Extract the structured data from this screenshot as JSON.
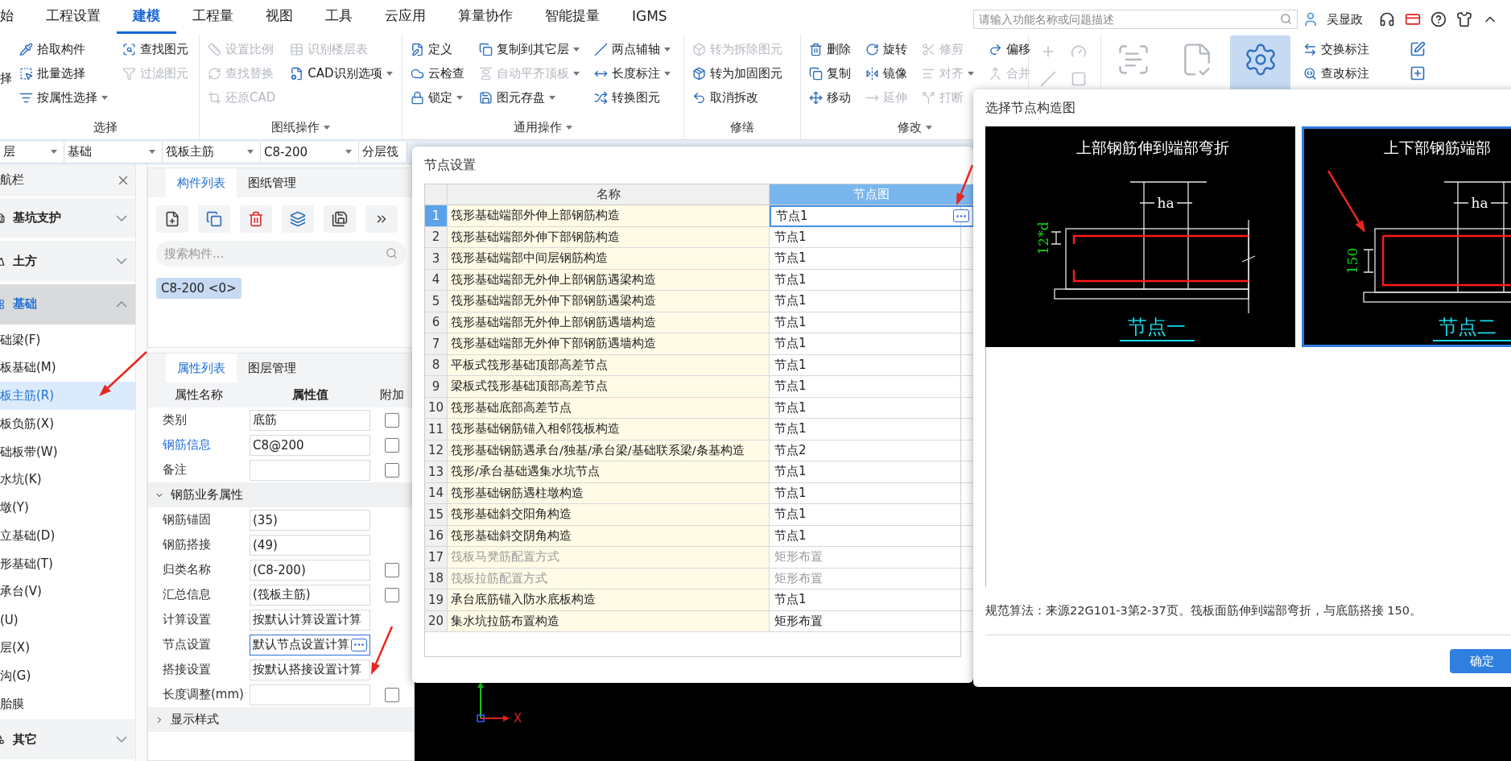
{
  "menu_tabs": [
    {
      "label": "始",
      "selected": false
    },
    {
      "label": "工程设置",
      "selected": false
    },
    {
      "label": "建模",
      "selected": true
    },
    {
      "label": "工程量",
      "selected": false
    },
    {
      "label": "视图",
      "selected": false
    },
    {
      "label": "工具",
      "selected": false
    },
    {
      "label": "云应用",
      "selected": false
    },
    {
      "label": "算量协作",
      "selected": false
    },
    {
      "label": "智能提量",
      "selected": false
    },
    {
      "label": "IGMS",
      "selected": false
    }
  ],
  "search": {
    "placeholder": "请输入功能名称或问题描述"
  },
  "user": {
    "name": "吴显政"
  },
  "ribbon": {
    "lead_button": {
      "label": "择"
    },
    "groups": [
      {
        "label": "选择",
        "has_menu": false,
        "columns": [
          [
            {
              "label": "拾取构件",
              "disabled": false,
              "dropdown": false
            },
            {
              "label": "批量选择",
              "disabled": false,
              "dropdown": false
            },
            {
              "label": "按属性选择",
              "disabled": false,
              "dropdown": true
            }
          ],
          [
            {
              "label": "查找图元",
              "disabled": false,
              "dropdown": false
            },
            {
              "label": "过滤图元",
              "disabled": true,
              "dropdown": false
            }
          ]
        ]
      },
      {
        "label": "图纸操作",
        "has_menu": true,
        "columns": [
          [
            {
              "label": "设置比例",
              "disabled": true,
              "dropdown": false
            },
            {
              "label": "查找替换",
              "disabled": true,
              "dropdown": false
            },
            {
              "label": "还原CAD",
              "disabled": true,
              "dropdown": false
            }
          ],
          [
            {
              "label": "识别楼层表",
              "disabled": true,
              "dropdown": false
            },
            {
              "label": "CAD识别选项",
              "disabled": false,
              "dropdown": true
            }
          ]
        ]
      },
      {
        "label": "通用操作",
        "has_menu": true,
        "columns": [
          [
            {
              "label": "定义",
              "disabled": false,
              "dropdown": false
            },
            {
              "label": "云检查",
              "disabled": false,
              "dropdown": false
            },
            {
              "label": "锁定",
              "disabled": false,
              "dropdown": true
            }
          ],
          [
            {
              "label": "复制到其它层",
              "disabled": false,
              "dropdown": true
            },
            {
              "label": "自动平齐顶板",
              "disabled": true,
              "dropdown": true
            },
            {
              "label": "图元存盘",
              "disabled": false,
              "dropdown": true
            }
          ],
          [
            {
              "label": "两点辅轴",
              "disabled": false,
              "dropdown": true
            },
            {
              "label": "长度标注",
              "disabled": false,
              "dropdown": true
            },
            {
              "label": "转换图元",
              "disabled": false,
              "dropdown": false
            }
          ]
        ]
      },
      {
        "label": "修缮",
        "has_menu": false,
        "columns": [
          [
            {
              "label": "转为拆除图元",
              "disabled": true,
              "dropdown": false
            },
            {
              "label": "转为加固图元",
              "disabled": false,
              "dropdown": false
            },
            {
              "label": "取消拆改",
              "disabled": false,
              "dropdown": false
            }
          ]
        ]
      },
      {
        "label": "修改",
        "has_menu": true,
        "columns": [
          [
            {
              "label": "删除",
              "disabled": false,
              "dropdown": false
            },
            {
              "label": "复制",
              "disabled": false,
              "dropdown": false
            },
            {
              "label": "移动",
              "disabled": false,
              "dropdown": false
            }
          ],
          [
            {
              "label": "旋转",
              "disabled": false,
              "dropdown": false
            },
            {
              "label": "镜像",
              "disabled": false,
              "dropdown": false
            },
            {
              "label": "延伸",
              "disabled": true,
              "dropdown": false
            }
          ],
          [
            {
              "label": "修剪",
              "disabled": true,
              "dropdown": false
            },
            {
              "label": "对齐",
              "disabled": true,
              "dropdown": true
            },
            {
              "label": "打断",
              "disabled": true,
              "dropdown": false
            }
          ],
          [
            {
              "label": "偏移",
              "disabled": false,
              "dropdown": false
            },
            {
              "label": "合并",
              "disabled": true,
              "dropdown": false
            }
          ]
        ]
      }
    ],
    "big_buttons": [
      {
        "selected": false,
        "disabled": true
      },
      {
        "selected": false,
        "disabled": true
      },
      {
        "selected": true,
        "disabled": false
      }
    ],
    "label_tools": [
      {
        "label": "交换标注"
      },
      {
        "label": "查改标注"
      }
    ]
  },
  "selector_bar": [
    {
      "value": "层"
    },
    {
      "value": "基础"
    },
    {
      "value": "筏板主筋"
    },
    {
      "value": "C8-200"
    },
    {
      "value": "分层筏"
    }
  ],
  "navigation": {
    "title": "航栏",
    "groups": [
      {
        "label": "基坑支护",
        "expanded": false,
        "selected": false
      },
      {
        "label": "土方",
        "expanded": false,
        "selected": false
      },
      {
        "label": "基础",
        "expanded": true,
        "selected": true,
        "children": [
          {
            "label": "础梁(F)",
            "selected": false
          },
          {
            "label": "板基础(M)",
            "selected": false
          },
          {
            "label": "板主筋(R)",
            "selected": true
          },
          {
            "label": "板负筋(X)",
            "selected": false
          },
          {
            "label": "础板带(W)",
            "selected": false
          },
          {
            "label": "水坑(K)",
            "selected": false
          },
          {
            "label": "墩(Y)",
            "selected": false
          },
          {
            "label": "立基础(D)",
            "selected": false
          },
          {
            "label": "形基础(T)",
            "selected": false
          },
          {
            "label": "承台(V)",
            "selected": false
          },
          {
            "label": "(U)",
            "selected": false
          },
          {
            "label": "层(X)",
            "selected": false
          },
          {
            "label": "沟(G)",
            "selected": false
          },
          {
            "label": "胎膜",
            "selected": false
          }
        ]
      },
      {
        "label": "其它",
        "expanded": false,
        "selected": false
      }
    ]
  },
  "component_panel": {
    "tabs": [
      {
        "label": "构件列表",
        "selected": true
      },
      {
        "label": "图纸管理",
        "selected": false
      }
    ],
    "search": {
      "placeholder": "搜索构件..."
    },
    "items": [
      {
        "label": "C8-200 <0>",
        "selected": true
      }
    ]
  },
  "property_panel": {
    "tabs": [
      {
        "label": "属性列表",
        "selected": true
      },
      {
        "label": "图层管理",
        "selected": false
      }
    ],
    "columns": [
      "属性名称",
      "属性值",
      "附加"
    ],
    "rows": [
      {
        "kind": "row",
        "name": "类别",
        "value": "底筋",
        "link": false,
        "checked": false
      },
      {
        "kind": "row",
        "name": "钢筋信息",
        "value": "C8@200",
        "link": true,
        "checked": false
      },
      {
        "kind": "row",
        "name": "备注",
        "link": false,
        "checked": false
      },
      {
        "kind": "section",
        "label": "钢筋业务属性",
        "expanded": true
      },
      {
        "kind": "row",
        "name": "钢筋锚固",
        "value": "(35)",
        "link": false
      },
      {
        "kind": "row",
        "name": "钢筋搭接",
        "value": "(49)",
        "link": false
      },
      {
        "kind": "row",
        "name": "归类名称",
        "value": "(C8-200)",
        "link": false,
        "checked": false
      },
      {
        "kind": "row",
        "name": "汇总信息",
        "value": "(筏板主筋)",
        "link": false,
        "checked": false
      },
      {
        "kind": "row",
        "name": "计算设置",
        "value": "按默认计算设置计算",
        "link": false
      },
      {
        "kind": "picker",
        "name": "节点设置",
        "value": "默认节点设置计算",
        "link": false,
        "focused": true
      },
      {
        "kind": "row",
        "name": "搭接设置",
        "value": "按默认搭接设置计算",
        "link": false
      },
      {
        "kind": "row",
        "name": "长度调整(mm)",
        "link": false,
        "checked": false
      },
      {
        "kind": "section",
        "label": "显示样式",
        "expanded": false
      }
    ]
  },
  "canvas": {
    "axis_label": "X"
  },
  "node_dialog": {
    "title": "节点设置",
    "columns": [
      "名称",
      "节点图"
    ],
    "rows": [
      {
        "index": "1",
        "name": "筏形基础端部外伸上部钢筋构造",
        "value": "节点1",
        "disabled": false,
        "selected": true
      },
      {
        "index": "2",
        "name": "筏形基础端部外伸下部钢筋构造",
        "value": "节点1",
        "disabled": false,
        "selected": false
      },
      {
        "index": "3",
        "name": "筏形基础端部中间层钢筋构造",
        "value": "节点1",
        "disabled": false,
        "selected": false
      },
      {
        "index": "4",
        "name": "筏形基础端部无外伸上部钢筋遇梁构造",
        "value": "节点1",
        "disabled": false,
        "selected": false
      },
      {
        "index": "5",
        "name": "筏形基础端部无外伸下部钢筋遇梁构造",
        "value": "节点1",
        "disabled": false,
        "selected": false
      },
      {
        "index": "6",
        "name": "筏形基础端部无外伸上部钢筋遇墙构造",
        "value": "节点1",
        "disabled": false,
        "selected": false
      },
      {
        "index": "7",
        "name": "筏形基础端部无外伸下部钢筋遇墙构造",
        "value": "节点1",
        "disabled": false,
        "selected": false
      },
      {
        "index": "8",
        "name": "平板式筏形基础顶部高差节点",
        "value": "节点1",
        "disabled": false,
        "selected": false
      },
      {
        "index": "9",
        "name": "梁板式筏形基础顶部高差节点",
        "value": "节点1",
        "disabled": false,
        "selected": false
      },
      {
        "index": "10",
        "name": "筏形基础底部高差节点",
        "value": "节点1",
        "disabled": false,
        "selected": false
      },
      {
        "index": "11",
        "name": "筏形基础钢筋锚入相邻筏板构造",
        "value": "节点1",
        "disabled": false,
        "selected": false
      },
      {
        "index": "12",
        "name": "筏形基础钢筋遇承台/独基/承台梁/基础联系梁/条基构造",
        "value": "节点2",
        "disabled": false,
        "selected": false
      },
      {
        "index": "13",
        "name": "筏形/承台基础遇集水坑节点",
        "value": "节点1",
        "disabled": false,
        "selected": false
      },
      {
        "index": "14",
        "name": "筏形基础钢筋遇柱墩构造",
        "value": "节点1",
        "disabled": false,
        "selected": false
      },
      {
        "index": "15",
        "name": "筏形基础斜交阳角构造",
        "value": "节点1",
        "disabled": false,
        "selected": false
      },
      {
        "index": "16",
        "name": "筏形基础斜交阴角构造",
        "value": "节点1",
        "disabled": false,
        "selected": false
      },
      {
        "index": "17",
        "name": "筏板马凳筋配置方式",
        "value": "矩形布置",
        "disabled": true,
        "selected": false
      },
      {
        "index": "18",
        "name": "筏板拉筋配置方式",
        "value": "矩形布置",
        "disabled": true,
        "selected": false
      },
      {
        "index": "19",
        "name": "承台底筋锚入防水底板构造",
        "value": "节点1",
        "disabled": false,
        "selected": false
      },
      {
        "index": "20",
        "name": "集水坑拉筋布置构造",
        "value": "矩形布置",
        "disabled": false,
        "selected": false
      }
    ]
  },
  "diagram_dialog": {
    "title": "选择节点构造图",
    "options": [
      {
        "kind": "bend",
        "title": "上部钢筋伸到端部弯折",
        "dim_label": "ha",
        "side_label": "12*d",
        "caption": "节点一",
        "selected": false
      },
      {
        "kind": "lap",
        "title": "上下部钢筋端部",
        "dim_label": "ha",
        "side_label": "150",
        "caption": "节点二",
        "selected": true
      }
    ],
    "description": "规范算法：来源22G101-3第2-37页。筏板面筋伸到端部弯折，与底筋搭接 150。",
    "confirm": "确定"
  }
}
